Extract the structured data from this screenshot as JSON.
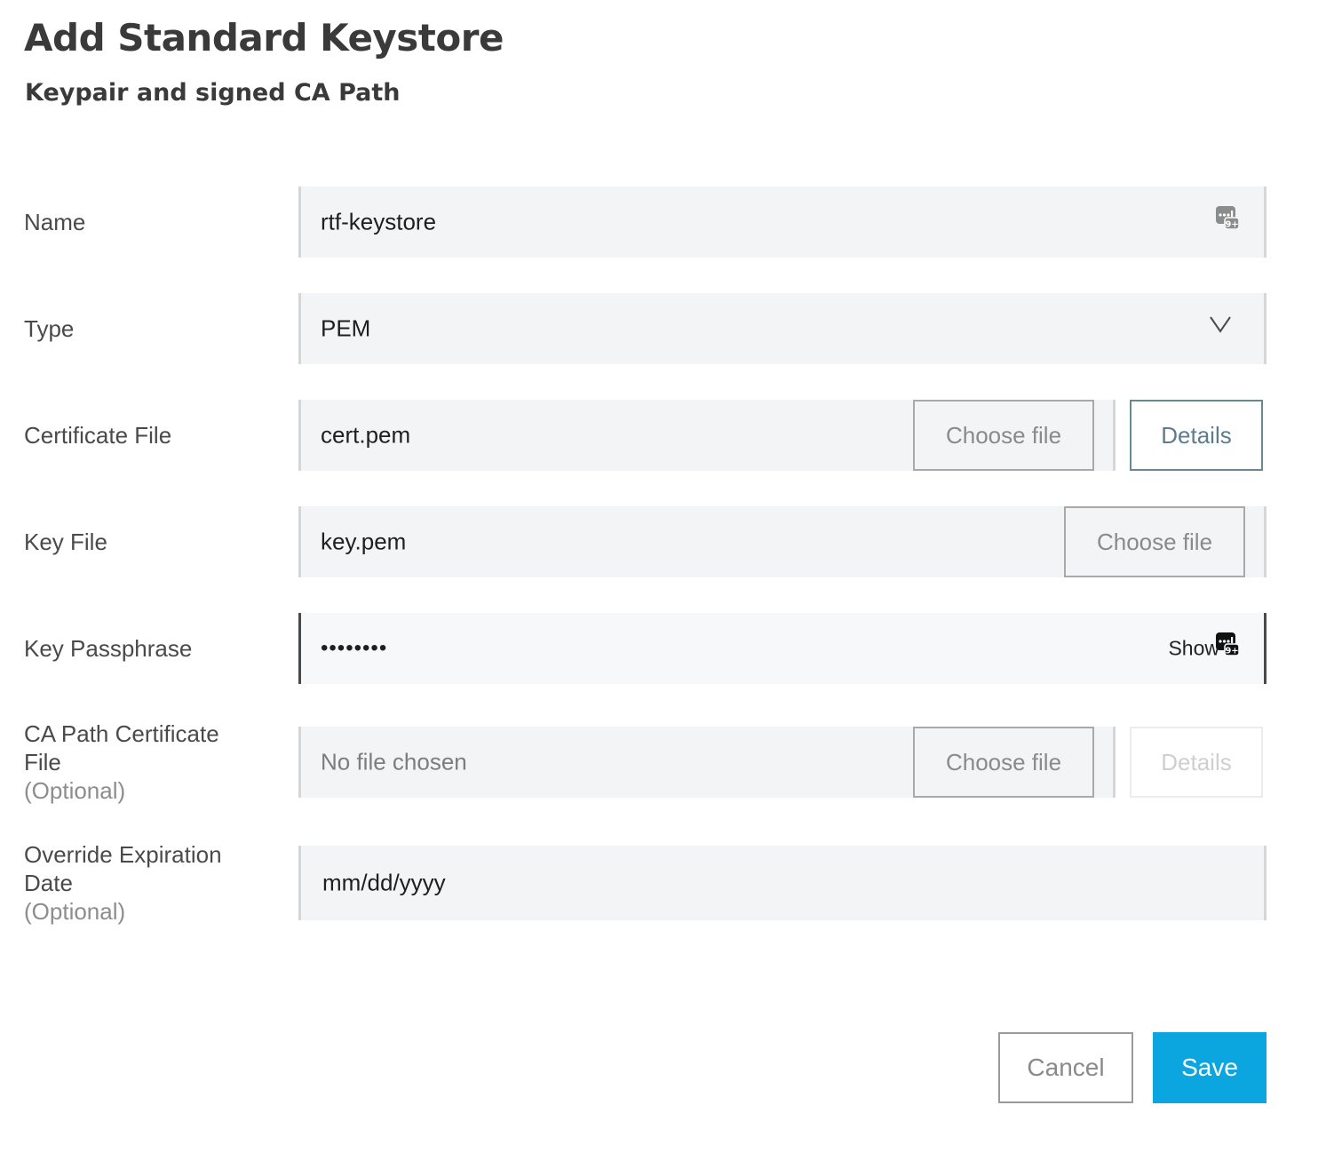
{
  "dialog": {
    "title": "Add Standard Keystore",
    "subtitle": "Keypair and signed CA Path"
  },
  "form": {
    "name": {
      "label": "Name",
      "value": "rtf-keystore",
      "icon": "password-manager-icon"
    },
    "type": {
      "label": "Type",
      "selected": "PEM",
      "icon": "chevron-down-icon"
    },
    "certificate_file": {
      "label": "Certificate File",
      "value": "cert.pem",
      "choose_label": "Choose file",
      "details_label": "Details"
    },
    "key_file": {
      "label": "Key File",
      "value": "key.pem",
      "choose_label": "Choose file"
    },
    "key_passphrase": {
      "label": "Key Passphrase",
      "value": "••••••••",
      "show_label": "Show",
      "icon": "password-manager-icon"
    },
    "ca_path_certificate_file": {
      "label_line1": "CA Path Certificate",
      "label_line2": "File",
      "optional": "(Optional)",
      "value": "No file chosen",
      "choose_label": "Choose file",
      "details_label": "Details"
    },
    "override_expiration_date": {
      "label_line1": "Override Expiration",
      "label_line2": "Date",
      "optional": "(Optional)",
      "value": "mm/dd/yyyy"
    }
  },
  "actions": {
    "cancel_label": "Cancel",
    "save_label": "Save"
  },
  "colors": {
    "primary": "#0ba5e0",
    "field_bg": "#f3f4f6",
    "details_border": "#6a8796"
  }
}
